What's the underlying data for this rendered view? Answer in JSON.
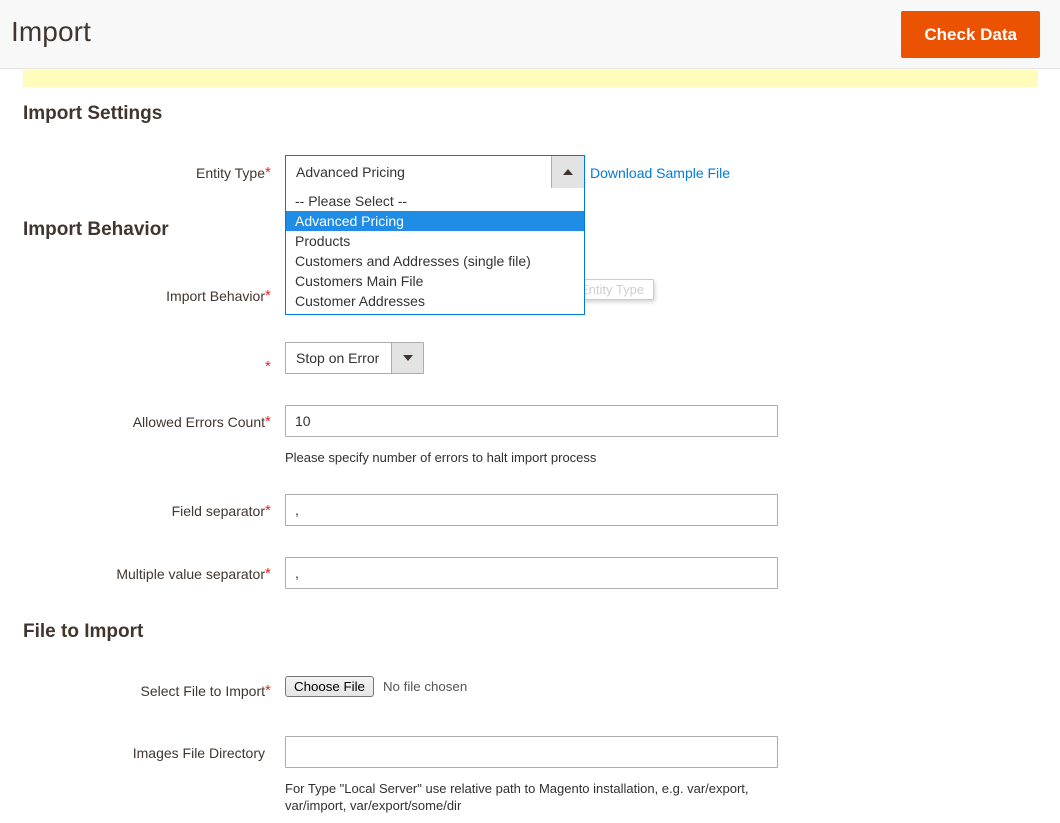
{
  "header": {
    "title": "Import",
    "check_data_label": "Check Data"
  },
  "sections": {
    "import_settings_title": "Import Settings",
    "import_behavior_title": "Import Behavior",
    "file_to_import_title": "File to Import"
  },
  "entity_type": {
    "label": "Entity Type",
    "required_mark": "*",
    "value": "Advanced Pricing",
    "expanded": true,
    "download_sample_link": "Download Sample File",
    "tooltip": "Entity Type",
    "options": [
      {
        "label": "-- Please Select --",
        "selected": false
      },
      {
        "label": "Advanced Pricing",
        "selected": true
      },
      {
        "label": "Products",
        "selected": false
      },
      {
        "label": "Customers and Addresses (single file)",
        "selected": false
      },
      {
        "label": "Customers Main File",
        "selected": false
      },
      {
        "label": "Customer Addresses",
        "selected": false
      }
    ]
  },
  "import_behavior": {
    "label": "Import Behavior",
    "required_mark": "*",
    "second_required_mark": "*",
    "value": "Stop on Error"
  },
  "allowed_errors": {
    "label": "Allowed Errors Count",
    "required_mark": "*",
    "value": "10",
    "note": "Please specify number of errors to halt import process"
  },
  "field_separator": {
    "label": "Field separator",
    "required_mark": "*",
    "value": ","
  },
  "multiple_value_separator": {
    "label": "Multiple value separator",
    "required_mark": "*",
    "value": ","
  },
  "select_file": {
    "label": "Select File to Import",
    "required_mark": "*",
    "choose_file_label": "Choose File",
    "no_file_text": "No file chosen"
  },
  "images_directory": {
    "label": "Images File Directory",
    "value": "",
    "placeholder": "",
    "note": "For Type \"Local Server\" use relative path to Magento installation, e.g. var/export, var/import, var/export/some/dir"
  },
  "colors": {
    "accent_orange": "#eb5202",
    "link_blue": "#007bdb",
    "highlight_blue": "#1f8ce6",
    "notice_yellow": "#fffbbb",
    "required_red": "#e22626"
  }
}
